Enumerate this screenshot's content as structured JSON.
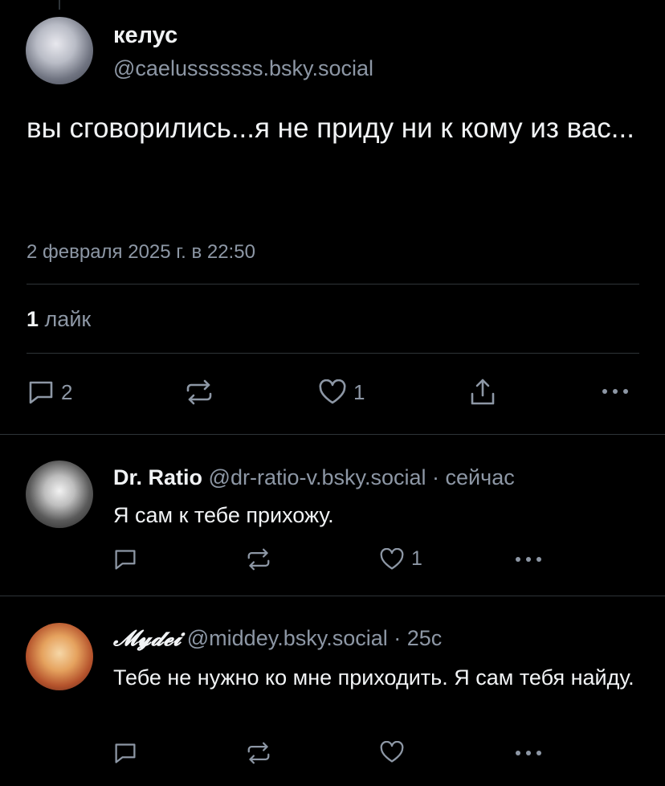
{
  "post": {
    "author_name": "келус",
    "author_handle": "@caelusssssss.bsky.social",
    "text": "вы сговорились...я не приду ни к кому из вас...",
    "date": "2 февраля 2025 г. в 22:50",
    "likes_count": "1",
    "likes_label": "лайк",
    "actions": {
      "reply_count": "2",
      "like_count": "1"
    }
  },
  "replies": [
    {
      "author_name": "Dr. Ratio",
      "handle": "@dr-ratio-v.bsky.social",
      "time": "· сейчас",
      "text": "Я сам к тебе прихожу.",
      "like_count": "1"
    },
    {
      "author_name": "𝓜𝔂𝓭𝓮𝓲",
      "handle": "@middey.bsky.social",
      "time": "· 25с",
      "text": "Тебе не нужно ко мне приходить. Я сам тебя найду."
    }
  ],
  "colors": {
    "background": "#000000",
    "text_primary": "#f1f3f5",
    "text_secondary": "#8d97a5",
    "divider": "#2e3438"
  },
  "icons": [
    "reply-icon",
    "repost-icon",
    "like-icon",
    "share-icon",
    "more-icon"
  ]
}
